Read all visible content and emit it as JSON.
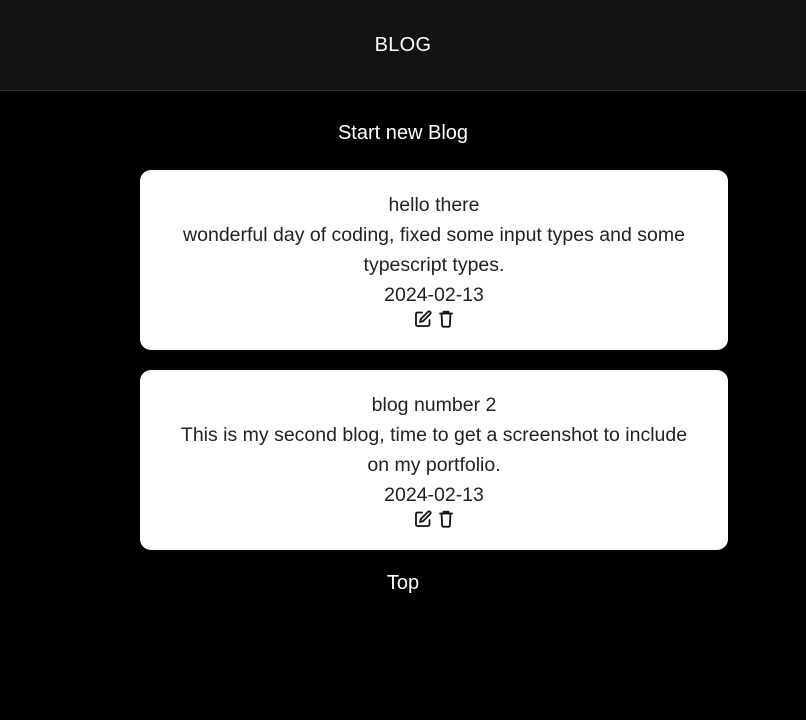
{
  "header": {
    "title": "BLOG"
  },
  "actions": {
    "new_blog_label": "Start new Blog",
    "top_label": "Top"
  },
  "posts": [
    {
      "title": "hello there",
      "body": "wonderful day of coding, fixed some input types and some typescript types.",
      "date": "2024-02-13",
      "icons": [
        "edit-icon",
        "trash-icon"
      ]
    },
    {
      "title": "blog number 2",
      "body": "This is my second blog, time to get a screenshot to include on my portfolio.",
      "date": "2024-02-13",
      "icons": [
        "edit-icon",
        "trash-icon"
      ]
    }
  ],
  "colors": {
    "page_background": "#000000",
    "header_background": "#121212",
    "card_background": "#ffffff",
    "card_text": "#222222",
    "header_text": "#ffffff"
  }
}
